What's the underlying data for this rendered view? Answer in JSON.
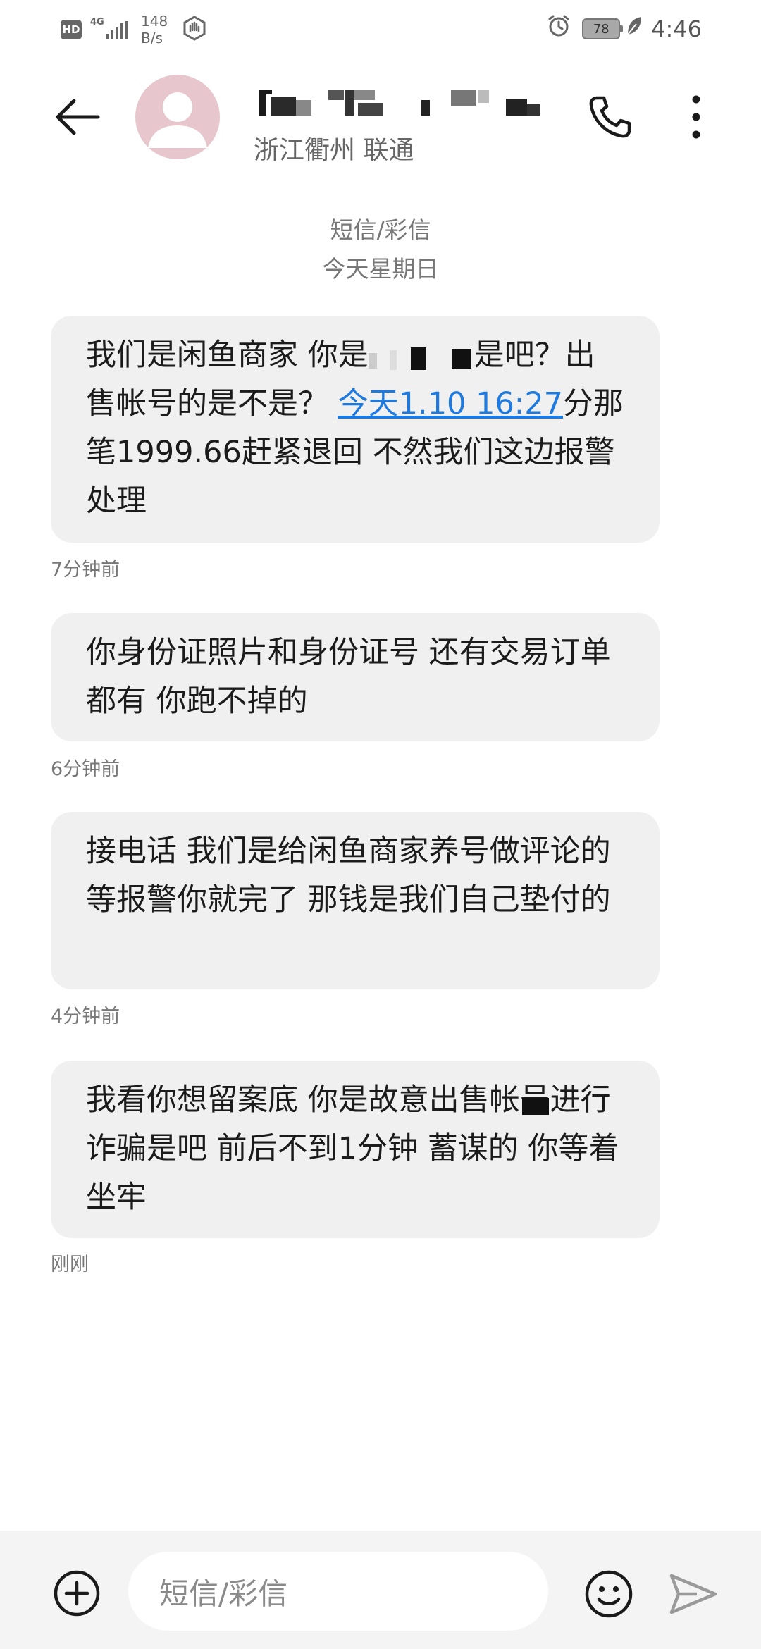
{
  "status_bar": {
    "hd": "HD",
    "network": "4G",
    "speed_value": "148",
    "speed_unit": "B/s",
    "battery": "78",
    "time": "4:46"
  },
  "header": {
    "contact_location": "浙江衢州 联通"
  },
  "thread": {
    "type_label": "短信/彩信",
    "date_label": "今天星期日"
  },
  "messages": [
    {
      "part1": "我们是闲鱼商家 你是",
      "part2": "是吧？出售帐号的是不是？",
      "link": "今天1.10 16:27",
      "part3": "分那笔1999.66赶紧退回 不然我们这边报警处理",
      "time": "7分钟前"
    },
    {
      "text": "你身份证照片和身份证号 还有交易订单都有 你跑不掉的",
      "time": "6分钟前"
    },
    {
      "text": "接电话 我们是给闲鱼商家养号做评论的 等报警你就完了 那钱是我们自己垫付的",
      "time": "4分钟前"
    },
    {
      "part1": "我看你想留案底 你是故意出售帐号",
      "part2": "进行诈骗是吧 前后不到1分钟 蓄谋的 你等着坐牢",
      "time": "刚刚"
    }
  ],
  "composer": {
    "placeholder": "短信/彩信"
  },
  "colors": {
    "bubble": "#f0f0f0",
    "link": "#1f7ae0",
    "avatar_bg": "#e8c6cd"
  },
  "icons": [
    "hd-icon",
    "signal-icon",
    "hand-icon",
    "alarm-icon",
    "battery-icon",
    "leaf-icon",
    "back-arrow-icon",
    "avatar-icon",
    "phone-icon",
    "more-vertical-icon",
    "add-circle-icon",
    "emoji-icon",
    "send-icon"
  ]
}
